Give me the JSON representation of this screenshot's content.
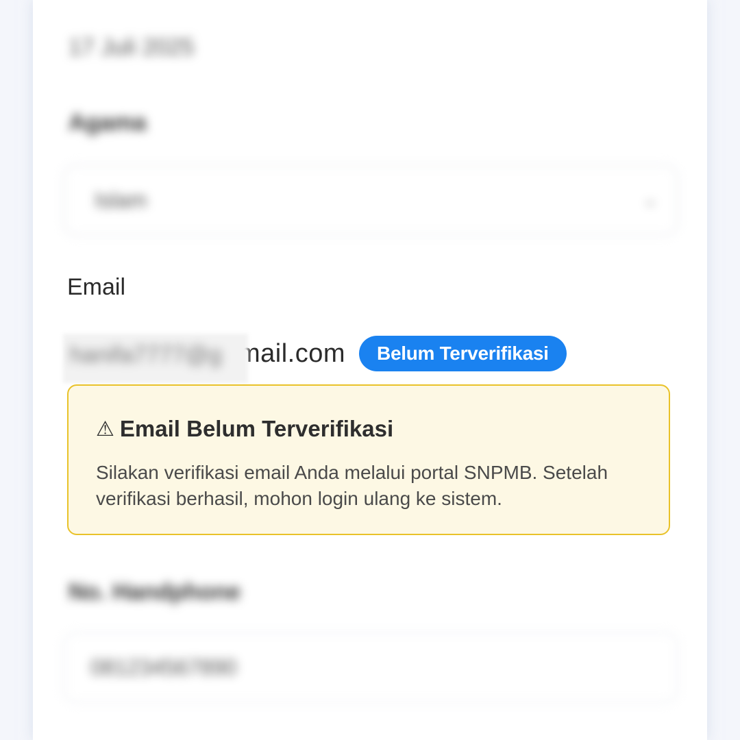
{
  "form": {
    "date_value": "17 Juli 2025",
    "religion_label": "Agama",
    "religion_value": "Islam",
    "religion_chevron_icon": "chevron-down-icon",
    "email_label": "Email",
    "email_masked_prefix": "hanifa7777@g",
    "email_domain_visible": "mail.com",
    "email_status_badge": "Belum Terverifikasi",
    "phone_label": "No. Handphone",
    "phone_value": "081234567890"
  },
  "alert": {
    "icon": "warning-icon",
    "icon_glyph": "⚠",
    "title": "Email Belum Terverifikasi",
    "body": "Silakan verifikasi email Anda melalui portal SNPMB. Setelah verifikasi berhasil, mohon login ulang ke sistem."
  },
  "colors": {
    "badge_bg": "#1a82f0",
    "alert_border": "#e9c229",
    "alert_bg": "#fdf8e4"
  }
}
